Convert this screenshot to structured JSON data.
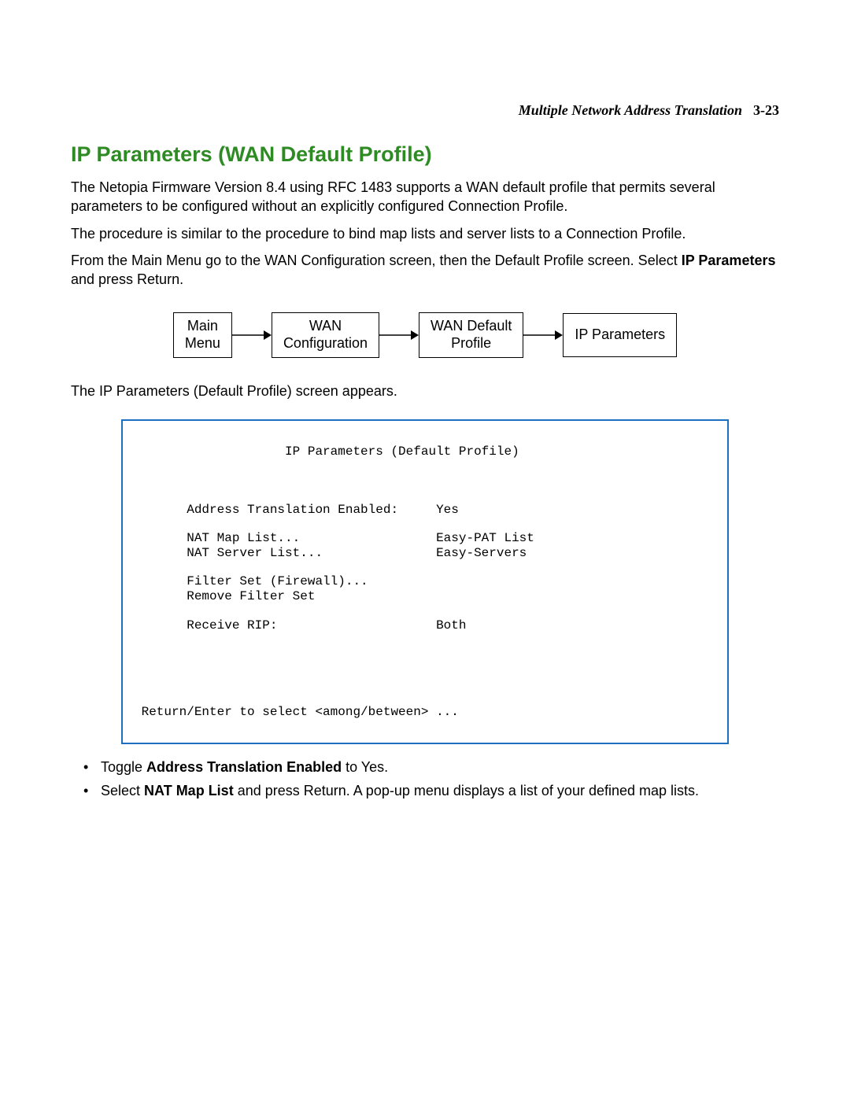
{
  "header": {
    "section": "Multiple Network Address Translation",
    "page": "3-23"
  },
  "title": "IP Parameters (WAN Default Profile)",
  "para1": "The Netopia Firmware Version 8.4 using RFC 1483 supports a WAN default profile that permits several parameters to be configured without an explicitly configured Connection Profile.",
  "para2": "The procedure is similar to the procedure to bind map lists and server lists to a Connection Profile.",
  "para3_pre": "From the Main Menu go to the WAN Configuration screen, then the Default Profile screen. Select ",
  "para3_bold": "IP Parameters",
  "para3_post": " and press Return.",
  "flow": {
    "box1": "Main\nMenu",
    "box2": "WAN\nConfiguration",
    "box3": "WAN Default\nProfile",
    "box4": "IP Parameters"
  },
  "para4": "The IP Parameters (Default Profile) screen appears.",
  "terminal": {
    "title": "IP Parameters (Default Profile)",
    "rows": [
      {
        "label": "Address Translation Enabled:",
        "value": "Yes"
      },
      {
        "label": "",
        "value": ""
      },
      {
        "label": "NAT Map List...",
        "value": "Easy-PAT List"
      },
      {
        "label": "NAT Server List...",
        "value": "Easy-Servers"
      },
      {
        "label": "",
        "value": ""
      },
      {
        "label": "Filter Set (Firewall)...",
        "value": ""
      },
      {
        "label": "Remove Filter Set",
        "value": ""
      },
      {
        "label": "",
        "value": ""
      },
      {
        "label": "Receive RIP:",
        "value": "Both"
      }
    ],
    "footer": "Return/Enter to select <among/between> ..."
  },
  "bullets": {
    "b1_pre": "Toggle ",
    "b1_bold": "Address Translation Enabled",
    "b1_post": " to Yes.",
    "b2_pre": "Select ",
    "b2_bold": "NAT Map List",
    "b2_post": " and press Return. A pop-up menu displays a list of your defined map lists."
  }
}
